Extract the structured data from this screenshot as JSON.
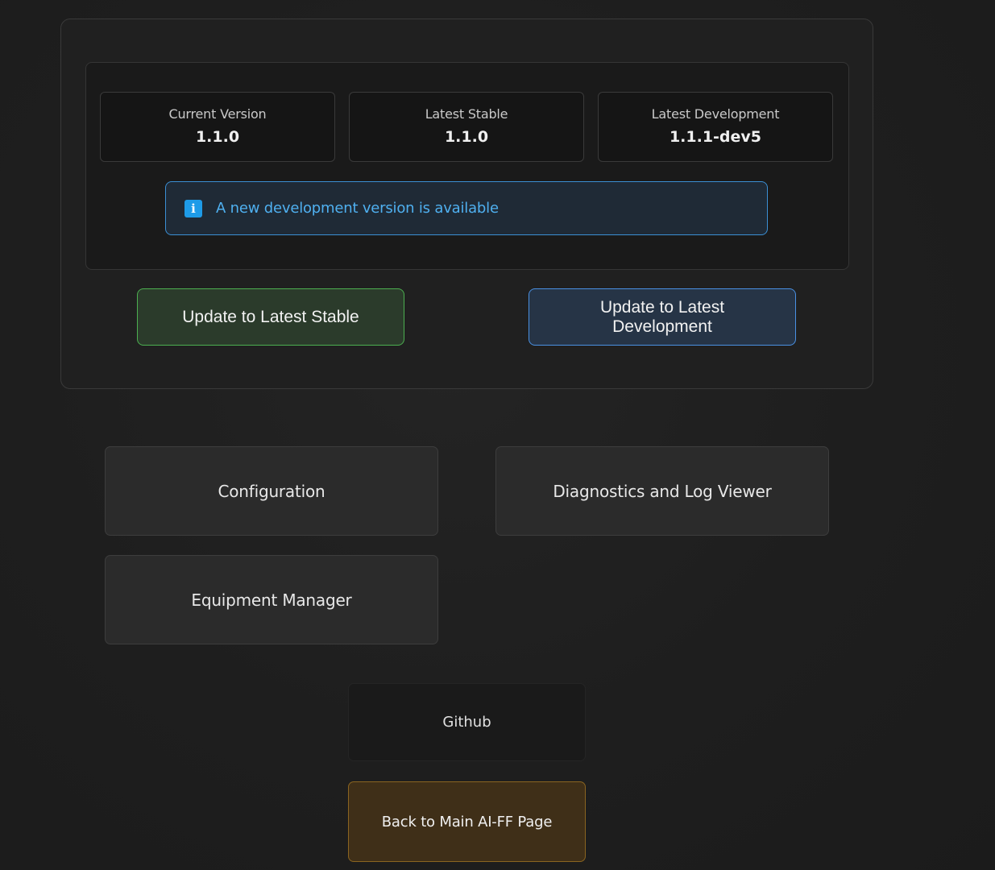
{
  "versions": {
    "current": {
      "label": "Current Version",
      "value": "1.1.0"
    },
    "stable": {
      "label": "Latest Stable",
      "value": "1.1.0"
    },
    "development": {
      "label": "Latest Development",
      "value": "1.1.1-dev5"
    }
  },
  "notice": {
    "icon": "info-icon",
    "icon_glyph": "i",
    "message": "A new development version is available",
    "color": "#4fb0f0"
  },
  "update_buttons": {
    "stable_label": "Update to Latest Stable",
    "dev_label": "Update to Latest Development"
  },
  "nav": {
    "configuration": "Configuration",
    "diagnostics": "Diagnostics and Log Viewer",
    "equipment": "Equipment Manager",
    "github": "Github",
    "back": "Back to Main AI-FF Page"
  },
  "colors": {
    "stable_accent": "#4caf50",
    "dev_accent": "#4a90e2",
    "back_accent": "#8a6420",
    "background": "#1e1e1e"
  }
}
